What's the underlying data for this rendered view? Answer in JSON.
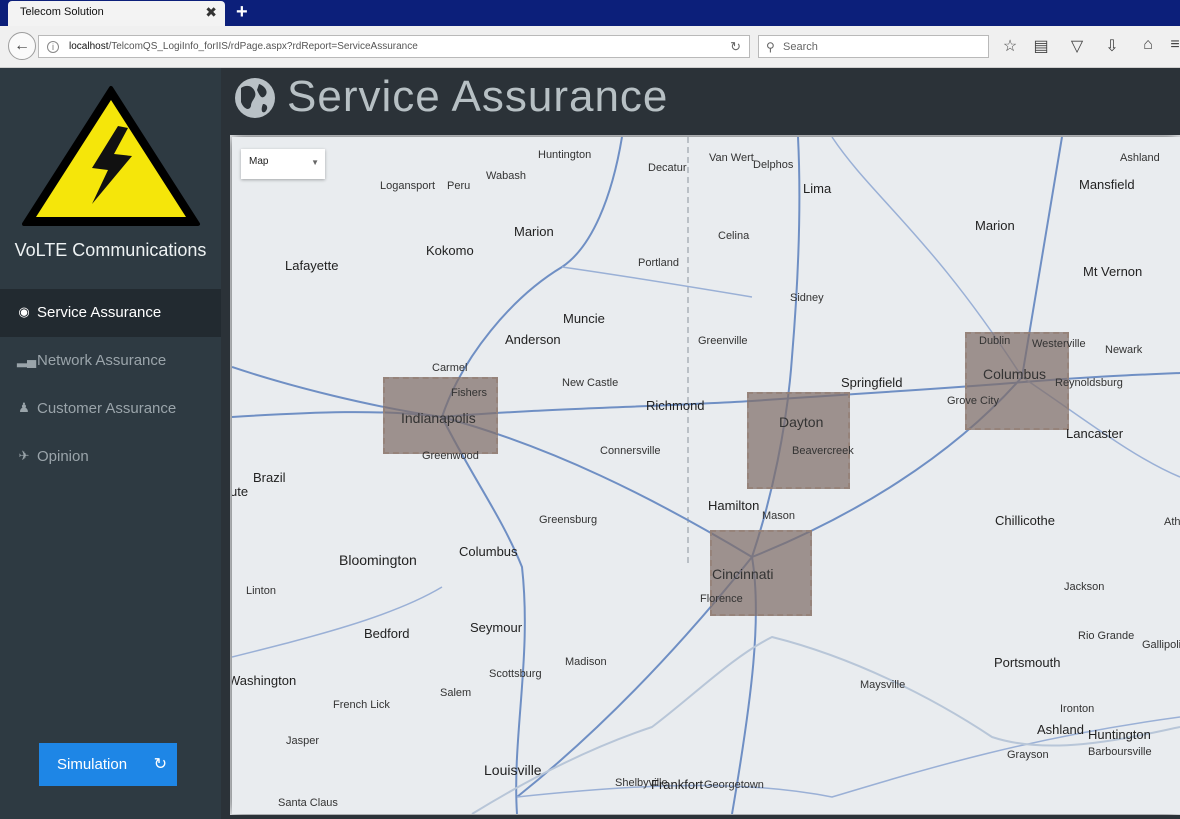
{
  "browser": {
    "tab_title": "Telecom Solution",
    "tab_close": "✖",
    "new_tab": "+",
    "url_host": "localhost",
    "url_path": "/TelcomQS_LogiInfo_forIIS/rdPage.aspx?rdReport=ServiceAssurance",
    "search_placeholder": "Search"
  },
  "sidebar": {
    "brand": "VoLTE Communications",
    "items": [
      {
        "label": "Service Assurance",
        "icon": "globe-icon",
        "active": true
      },
      {
        "label": "Network Assurance",
        "icon": "signal-bars-icon",
        "active": false
      },
      {
        "label": "Customer Assurance",
        "icon": "user-icon",
        "active": false
      },
      {
        "label": "Opinion",
        "icon": "comments-icon",
        "active": false
      }
    ],
    "simulation_label": "Simulation"
  },
  "header": {
    "title": "Service Assurance"
  },
  "map": {
    "type_selector": "Map",
    "zones": [
      "Indianapolis",
      "Dayton",
      "Columbus",
      "Cincinnati"
    ],
    "cities": [
      "Huntington",
      "Decatur",
      "Van Wert",
      "Delphos",
      "Ashland",
      "Logansport",
      "Peru",
      "Wabash",
      "Lima",
      "Mansfield",
      "Marion",
      "Celina",
      "Portland",
      "Kokomo",
      "Lafayette",
      "Marion",
      "Mt Vernon",
      "Sidney",
      "Muncie",
      "Anderson",
      "Greenville",
      "Newark",
      "Carmel",
      "Fishers",
      "New Castle",
      "Richmond",
      "Springfield",
      "Reynoldsburg",
      "Dublin",
      "Westerville",
      "Grove City",
      "Lancaster",
      "Greenwood",
      "Connersville",
      "Beavercreek",
      "Brazil",
      "Hamilton",
      "Mason",
      "Chillicothe",
      "Greensburg",
      "Columbus",
      "Bloomington",
      "Linton",
      "Florence",
      "Jackson",
      "Rio Grande",
      "Gallipolis",
      "Bedford",
      "Seymour",
      "Portsmouth",
      "Madison",
      "Washington",
      "Scottsburg",
      "Maysville",
      "Ironton",
      "Salem",
      "French Lick",
      "Ashland",
      "Huntington",
      "Jasper",
      "Grayson",
      "Barboursville",
      "Louisville",
      "Shelbyville",
      "Frankfort",
      "Georgetown",
      "Santa Claus",
      "ute",
      "Ath"
    ]
  }
}
